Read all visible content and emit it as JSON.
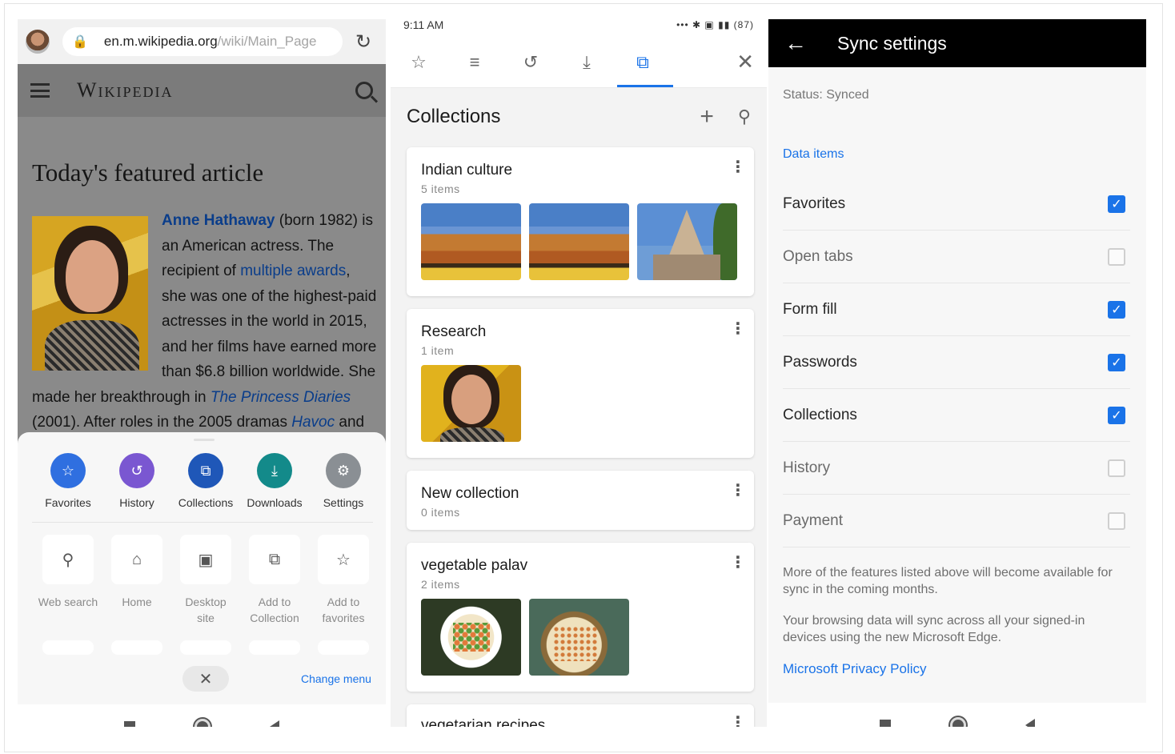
{
  "wiki": {
    "url_host": "en.m.wikipedia.org",
    "url_path": "/wiki/Main_Page",
    "logo": "Wikipedia",
    "featured_heading": "Today's featured article",
    "article": {
      "name": "Anne Hathaway",
      "t1": " (born 1982) is",
      "t2": "an American actress. The",
      "t3a": "recipient of ",
      "link_awards": "multiple awards",
      "t3b": ",",
      "t4": "she was one of the highest-paid",
      "t5": "actresses in the world in 2015,",
      "t6": "and her films have earned more",
      "t7": "than $6.8 billion worldwide. She",
      "t8a": "made her breakthrough in ",
      "link_princess": "The Princess Diaries",
      "t9a": "(2001). After roles in the 2005 dramas ",
      "link_havoc": "Havoc",
      "t9b": " and"
    },
    "menu_circles": [
      {
        "label": "Favorites",
        "icon": "star-icon",
        "color": "#2f6fe0"
      },
      {
        "label": "History",
        "icon": "history-icon",
        "color": "#7a57d1"
      },
      {
        "label": "Collections",
        "icon": "collections-icon",
        "color": "#1f57b8"
      },
      {
        "label": "Downloads",
        "icon": "download-icon",
        "color": "#138a8a"
      },
      {
        "label": "Settings",
        "icon": "gear-icon",
        "color": "#8a8f94"
      }
    ],
    "menu_tiles": [
      {
        "label1": "Web search",
        "label2": "",
        "icon": "search-icon"
      },
      {
        "label1": "Home",
        "label2": "",
        "icon": "home-icon"
      },
      {
        "label1": "Desktop",
        "label2": "site",
        "icon": "desktop-icon"
      },
      {
        "label1": "Add to",
        "label2": "Collection",
        "icon": "add-collection-icon"
      },
      {
        "label1": "Add to",
        "label2": "favorites",
        "icon": "add-favorite-icon"
      }
    ],
    "change_menu": "Change menu"
  },
  "collections": {
    "time": "9:11 AM",
    "battery": "87",
    "title": "Collections",
    "cards": [
      {
        "title": "Indian culture",
        "count": "5 items"
      },
      {
        "title": "Research",
        "count": "1 item"
      },
      {
        "title": "New collection",
        "count": "0 items"
      },
      {
        "title": "vegetable  palav",
        "count": "2 items"
      },
      {
        "title": "vegetarian recipes",
        "count": ""
      }
    ]
  },
  "sync": {
    "title": "Sync settings",
    "status": "Status: Synced",
    "section": "Data items",
    "items": [
      {
        "label": "Favorites",
        "checked": true
      },
      {
        "label": "Open tabs",
        "checked": false
      },
      {
        "label": "Form fill",
        "checked": true
      },
      {
        "label": "Passwords",
        "checked": true
      },
      {
        "label": "Collections",
        "checked": true
      },
      {
        "label": "History",
        "checked": false
      },
      {
        "label": "Payment",
        "checked": false
      }
    ],
    "note1": "More of the features listed above will become available for sync in the coming months.",
    "note2": "Your browsing data will sync across all your signed-in devices using the new Microsoft Edge.",
    "privacy_link": "Microsoft Privacy Policy"
  },
  "colors": {
    "accent": "#1a73e8",
    "header_black": "#000000"
  }
}
